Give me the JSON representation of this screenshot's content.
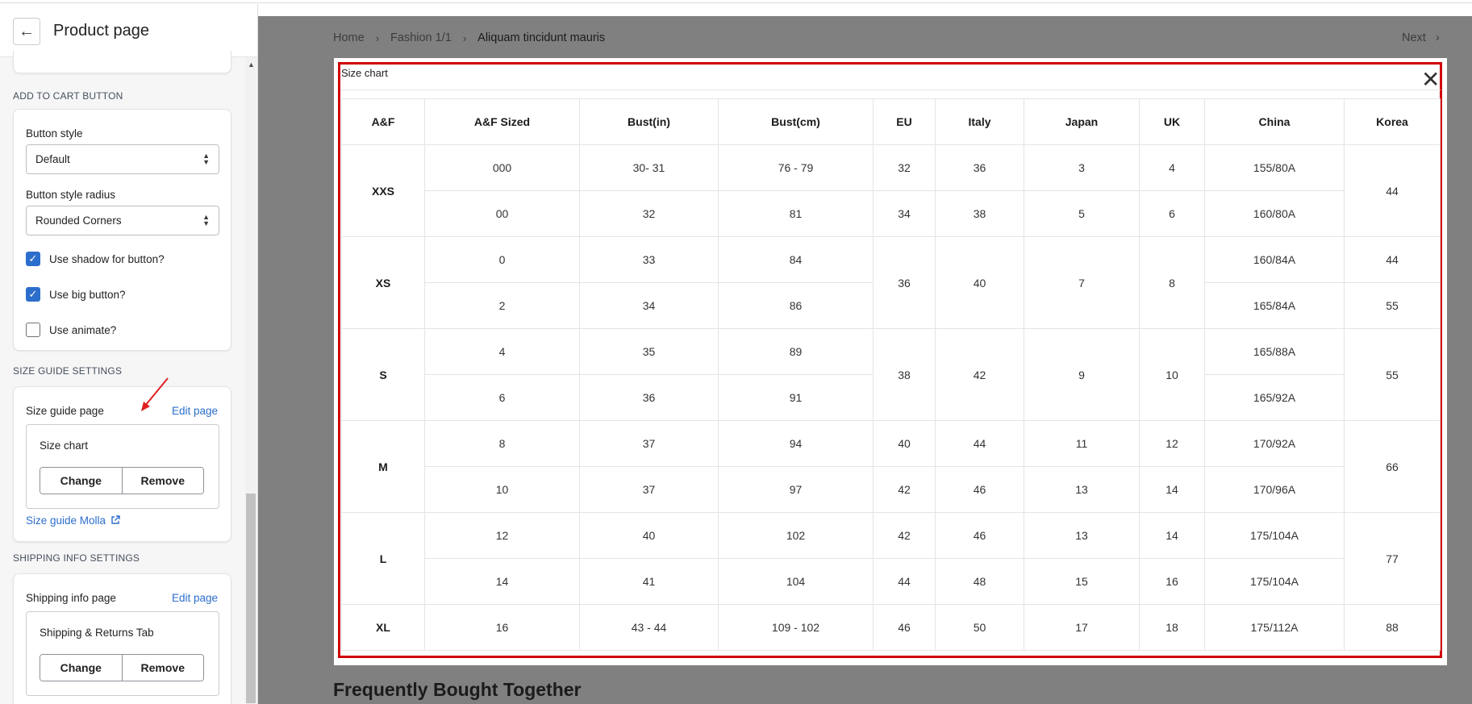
{
  "sidebar": {
    "title": "Product page",
    "add_to_cart": {
      "heading": "ADD TO CART BUTTON",
      "button_style_label": "Button style",
      "button_style_value": "Default",
      "radius_label": "Button style radius",
      "radius_value": "Rounded Corners",
      "checks": [
        {
          "label": "Use shadow for button?",
          "checked": true
        },
        {
          "label": "Use big button?",
          "checked": true
        },
        {
          "label": "Use animate?",
          "checked": false
        }
      ]
    },
    "size_guide": {
      "heading": "SIZE GUIDE SETTINGS",
      "page_label": "Size guide page",
      "edit_link": "Edit page",
      "selected_page": "Size chart",
      "change_label": "Change",
      "remove_label": "Remove",
      "external_link": "Size guide Molla"
    },
    "shipping": {
      "heading": "SHIPPING INFO SETTINGS",
      "page_label": "Shipping info page",
      "edit_link": "Edit page",
      "selected_page": "Shipping & Returns Tab",
      "change_label": "Change",
      "remove_label": "Remove"
    }
  },
  "preview": {
    "breadcrumb": [
      "Home",
      "Fashion 1/1",
      "Aliquam tincidunt mauris"
    ],
    "next_label": "Next",
    "section_heading": "Frequently Bought Together"
  },
  "modal": {
    "title": "Size chart",
    "headers": [
      "A&F",
      "A&F Sized",
      "Bust(in)",
      "Bust(cm)",
      "EU",
      "Italy",
      "Japan",
      "UK",
      "China",
      "Korea"
    ],
    "rows": {
      "XXS": {
        "size": "XXS",
        "a": {
          "sized": "000",
          "bin": "30- 31",
          "bcm": "76 - 79",
          "eu": "32",
          "it": "36",
          "jp": "3",
          "uk": "4",
          "cn": "155/80A"
        },
        "b": {
          "sized": "00",
          "bin": "32",
          "bcm": "81",
          "eu": "34",
          "it": "38",
          "jp": "5",
          "uk": "6",
          "cn": "160/80A"
        },
        "korea": "44"
      },
      "XS": {
        "size": "XS",
        "a": {
          "sized": "0",
          "bin": "33",
          "bcm": "84",
          "cn": "160/84A",
          "kr": "44"
        },
        "b": {
          "sized": "2",
          "bin": "34",
          "bcm": "86",
          "cn": "165/84A",
          "kr": "55"
        },
        "eu": "36",
        "it": "40",
        "jp": "7",
        "uk": "8"
      },
      "S": {
        "size": "S",
        "a": {
          "sized": "4",
          "bin": "35",
          "bcm": "89",
          "cn": "165/88A"
        },
        "b": {
          "sized": "6",
          "bin": "36",
          "bcm": "91",
          "cn": "165/92A"
        },
        "eu": "38",
        "it": "42",
        "jp": "9",
        "uk": "10",
        "korea": "55"
      },
      "M": {
        "size": "M",
        "a": {
          "sized": "8",
          "bin": "37",
          "bcm": "94",
          "eu": "40",
          "it": "44",
          "jp": "11",
          "uk": "12",
          "cn": "170/92A"
        },
        "b": {
          "sized": "10",
          "bin": "37",
          "bcm": "97",
          "eu": "42",
          "it": "46",
          "jp": "13",
          "uk": "14",
          "cn": "170/96A"
        },
        "korea": "66"
      },
      "L": {
        "size": "L",
        "a": {
          "sized": "12",
          "bin": "40",
          "bcm": "102",
          "eu": "42",
          "it": "46",
          "jp": "13",
          "uk": "14",
          "cn": "175/104A"
        },
        "b": {
          "sized": "14",
          "bin": "41",
          "bcm": "104",
          "eu": "44",
          "it": "48",
          "jp": "15",
          "uk": "16",
          "cn": "175/104A"
        },
        "korea": "77"
      },
      "XL": {
        "size": "XL",
        "sized": "16",
        "bin": "43 - 44",
        "bcm": "109 - 102",
        "eu": "46",
        "it": "50",
        "jp": "17",
        "uk": "18",
        "cn": "175/112A",
        "korea": "88"
      }
    }
  },
  "colors": {
    "accent": "#2c6ecb",
    "highlight_frame": "#d00000",
    "overlay": "#808080"
  }
}
